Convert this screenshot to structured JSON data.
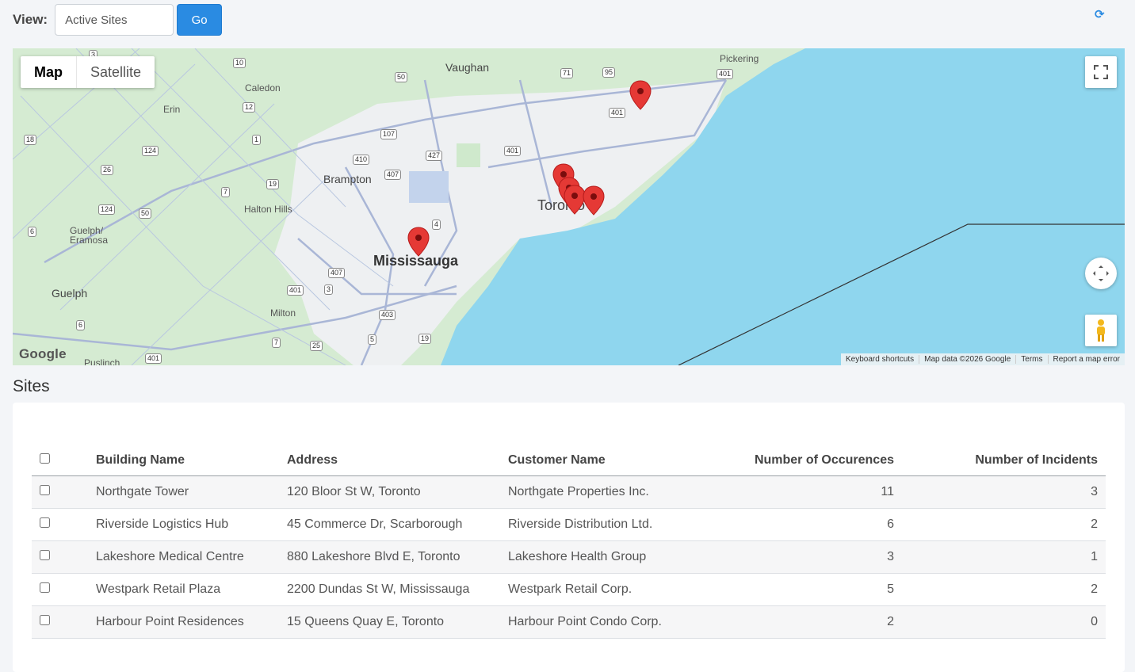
{
  "toolbar": {
    "view_label": "View:",
    "view_select_value": "Active Sites",
    "go_label": "Go",
    "refresh_icon": "refresh-icon"
  },
  "map": {
    "tabs": [
      {
        "label": "Map",
        "active": true
      },
      {
        "label": "Satellite",
        "active": false
      }
    ],
    "google_logo": "Google",
    "attribution": [
      "Keyboard shortcuts",
      "Map data ©2026 Google",
      "Terms",
      "Report a map error"
    ],
    "places": {
      "vaughan": "Vaughan",
      "pickering": "Pickering",
      "caledon": "Caledon",
      "erin": "Erin",
      "brampton": "Brampton",
      "halton_hills": "Halton Hills",
      "toronto": "Toronto",
      "mississauga": "Mississauga",
      "guelph_eramosa": "Guelph/\nEramosa",
      "guelph": "Guelph",
      "milton": "Milton",
      "puslinch": "Puslinch"
    },
    "markers_count": 6,
    "colors": {
      "water": "#8fd6ee",
      "land": "#d5ebd2",
      "urban": "#eef0f2",
      "marker": "#e53935"
    }
  },
  "sites": {
    "title": "Sites",
    "columns": [
      "Building Name",
      "Address",
      "Customer Name",
      "Number of Occurences",
      "Number of Incidents"
    ],
    "rows": [
      {
        "building": "Northgate Tower",
        "address": "120 Bloor St W, Toronto",
        "customer": "Northgate Properties Inc.",
        "occurrences": "11",
        "incidents": "3"
      },
      {
        "building": "Riverside Logistics Hub",
        "address": "45 Commerce Dr, Scarborough",
        "customer": "Riverside Distribution Ltd.",
        "occurrences": "6",
        "incidents": "2"
      },
      {
        "building": "Lakeshore Medical Centre",
        "address": "880 Lakeshore Blvd E, Toronto",
        "customer": "Lakeshore Health Group",
        "occurrences": "3",
        "incidents": "1"
      },
      {
        "building": "Westpark Retail Plaza",
        "address": "2200 Dundas St W, Mississauga",
        "customer": "Westpark Retail Corp.",
        "occurrences": "5",
        "incidents": "2"
      },
      {
        "building": "Harbour Point Residences",
        "address": "15 Queens Quay E, Toronto",
        "customer": "Harbour Point Condo Corp.",
        "occurrences": "2",
        "incidents": "0"
      }
    ]
  }
}
